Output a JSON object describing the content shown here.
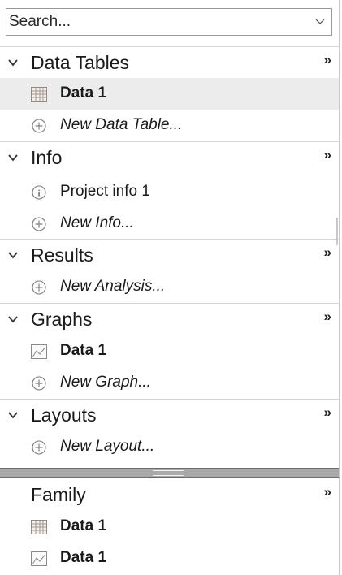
{
  "search": {
    "placeholder": "Search..."
  },
  "sections": [
    {
      "title": "Data Tables",
      "items": [
        {
          "label": "Data 1",
          "icon": "table-icon",
          "style": "bold",
          "selected": true
        },
        {
          "label": "New Data Table...",
          "icon": "plus-circle-icon",
          "style": "italic"
        }
      ]
    },
    {
      "title": "Info",
      "items": [
        {
          "label": "Project info 1",
          "icon": "info-icon",
          "style": "normal"
        },
        {
          "label": "New Info...",
          "icon": "plus-circle-icon",
          "style": "italic"
        }
      ]
    },
    {
      "title": "Results",
      "items": [
        {
          "label": "New Analysis...",
          "icon": "plus-circle-icon",
          "style": "italic"
        }
      ]
    },
    {
      "title": "Graphs",
      "items": [
        {
          "label": "Data 1",
          "icon": "graph-icon",
          "style": "bold"
        },
        {
          "label": "New Graph...",
          "icon": "plus-circle-icon",
          "style": "italic"
        }
      ]
    },
    {
      "title": "Layouts",
      "items": [
        {
          "label": "New Layout...",
          "icon": "plus-circle-icon",
          "style": "italic"
        }
      ]
    }
  ],
  "family": {
    "title": "Family",
    "items": [
      {
        "label": "Data 1",
        "icon": "table-icon",
        "style": "bold"
      },
      {
        "label": "Data 1",
        "icon": "graph-icon",
        "style": "bold"
      }
    ]
  },
  "more_glyph": "»",
  "colors": {
    "selected_row": "#ececec",
    "splitter": "#a9a9a9",
    "separator": "#d4d4d4"
  }
}
